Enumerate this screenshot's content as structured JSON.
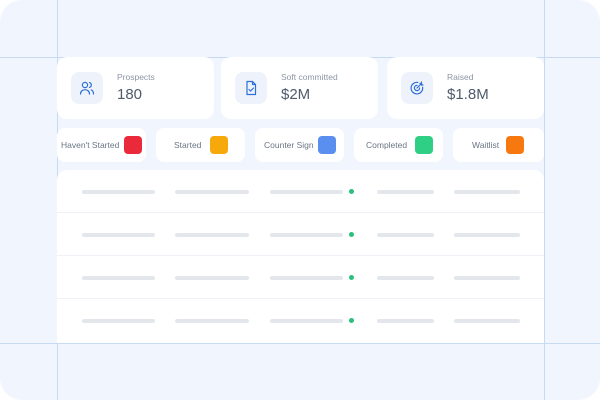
{
  "stats": [
    {
      "label": "Prospects",
      "value": "180",
      "icon": "users-icon"
    },
    {
      "label": "Soft committed",
      "value": "$2M",
      "icon": "document-check-icon"
    },
    {
      "label": "Raised",
      "value": "$1.8M",
      "icon": "target-icon"
    }
  ],
  "statuses": [
    {
      "label": "Haven't Started",
      "color": "#ea2a3b"
    },
    {
      "label": "Started",
      "color": "#f7a90c"
    },
    {
      "label": "Counter Sign",
      "color": "#5a8ff0"
    },
    {
      "label": "Completed",
      "color": "#2fcf86"
    },
    {
      "label": "Waitlist",
      "color": "#f7780f"
    }
  ],
  "colors": {
    "accent": "#2d6fd6",
    "background": "#f1f6fe",
    "status_dot": "#2bbf7c"
  }
}
